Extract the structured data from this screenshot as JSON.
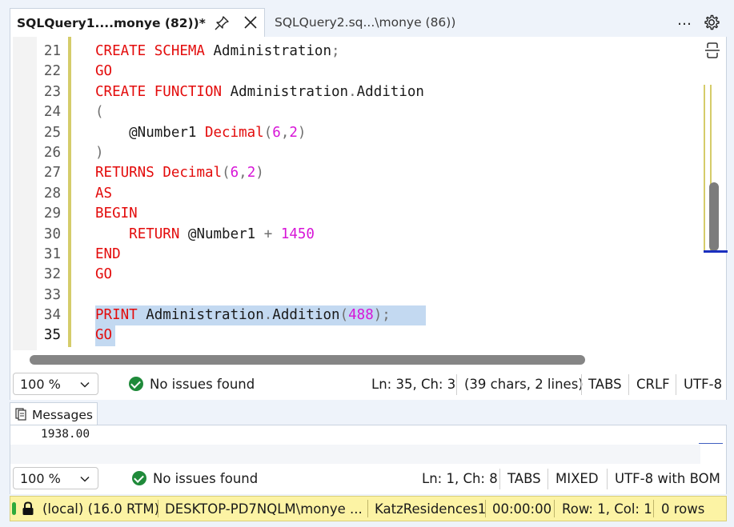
{
  "tabs": [
    {
      "label": "SQLQuery1....monye (82))*",
      "active": true
    },
    {
      "label": "SQLQuery2.sq...\\monye (86))",
      "active": false
    }
  ],
  "tab_menu_icon": "…",
  "editor": {
    "lines": [
      {
        "n": "21",
        "tokens": [
          [
            "kw",
            "CREATE SCHEMA"
          ],
          [
            "t",
            " Administration"
          ],
          [
            "op",
            ";"
          ]
        ]
      },
      {
        "n": "22",
        "tokens": [
          [
            "kw",
            "GO"
          ]
        ]
      },
      {
        "n": "23",
        "tokens": [
          [
            "kw",
            "CREATE FUNCTION"
          ],
          [
            "t",
            " Administration"
          ],
          [
            "op",
            "."
          ],
          [
            "t",
            "Addition"
          ]
        ]
      },
      {
        "n": "24",
        "tokens": [
          [
            "op",
            "("
          ]
        ]
      },
      {
        "n": "25",
        "tokens": [
          [
            "t",
            "    @Number1 "
          ],
          [
            "kw",
            "Decimal"
          ],
          [
            "op",
            "("
          ],
          [
            "num",
            "6"
          ],
          [
            "op",
            ","
          ],
          [
            "num",
            "2"
          ],
          [
            "op",
            ")"
          ]
        ]
      },
      {
        "n": "26",
        "tokens": [
          [
            "op",
            ")"
          ]
        ]
      },
      {
        "n": "27",
        "tokens": [
          [
            "kw",
            "RETURNS"
          ],
          [
            "t",
            " "
          ],
          [
            "kw",
            "Decimal"
          ],
          [
            "op",
            "("
          ],
          [
            "num",
            "6"
          ],
          [
            "op",
            ","
          ],
          [
            "num",
            "2"
          ],
          [
            "op",
            ")"
          ]
        ]
      },
      {
        "n": "28",
        "tokens": [
          [
            "kw",
            "AS"
          ]
        ]
      },
      {
        "n": "29",
        "tokens": [
          [
            "kw",
            "BEGIN"
          ]
        ]
      },
      {
        "n": "30",
        "tokens": [
          [
            "t",
            "    "
          ],
          [
            "kw",
            "RETURN"
          ],
          [
            "t",
            " @Number1 "
          ],
          [
            "op",
            "+"
          ],
          [
            "t",
            " "
          ],
          [
            "num",
            "1450"
          ]
        ]
      },
      {
        "n": "31",
        "tokens": [
          [
            "kw",
            "END"
          ]
        ]
      },
      {
        "n": "32",
        "tokens": [
          [
            "kw",
            "GO"
          ]
        ]
      },
      {
        "n": "33",
        "tokens": []
      },
      {
        "n": "34",
        "tokens": [
          [
            "kw",
            "PRINT"
          ],
          [
            "t",
            " Administration"
          ],
          [
            "op",
            "."
          ],
          [
            "t",
            "Addition"
          ],
          [
            "op",
            "("
          ],
          [
            "num",
            "488"
          ],
          [
            "op",
            ")"
          ],
          [
            "op",
            ";"
          ]
        ]
      },
      {
        "n": "35",
        "tokens": [
          [
            "kw",
            "GO"
          ]
        ]
      }
    ],
    "current_line": "35"
  },
  "status1": {
    "zoom": "100 %",
    "issues": "No issues found",
    "position": "Ln: 35, Ch: 3",
    "selection": "(39 chars, 2 lines)",
    "indent": "TABS",
    "line_ending": "CRLF",
    "encoding": "UTF-8"
  },
  "messages": {
    "tab_label": "Messages",
    "output": "1938.00"
  },
  "status2": {
    "zoom": "100 %",
    "issues": "No issues found",
    "position": "Ln: 1, Ch: 8",
    "indent": "TABS",
    "line_ending": "MIXED",
    "encoding": "UTF-8 with BOM"
  },
  "connection": {
    "server": "(local) (16.0 RTM)",
    "login": "DESKTOP-PD7NQLM\\monye ...",
    "database": "KatzResidences1",
    "elapsed": "00:00:00",
    "rowcol": "Row: 1, Col: 1",
    "rows": "0 rows"
  },
  "colors": {
    "keyword": "#e30b0b",
    "number": "#d715d7",
    "operator": "#707070",
    "selection": "#c3d9f1",
    "connection_bar": "#fcf3a4",
    "success": "#1f8a3a"
  }
}
